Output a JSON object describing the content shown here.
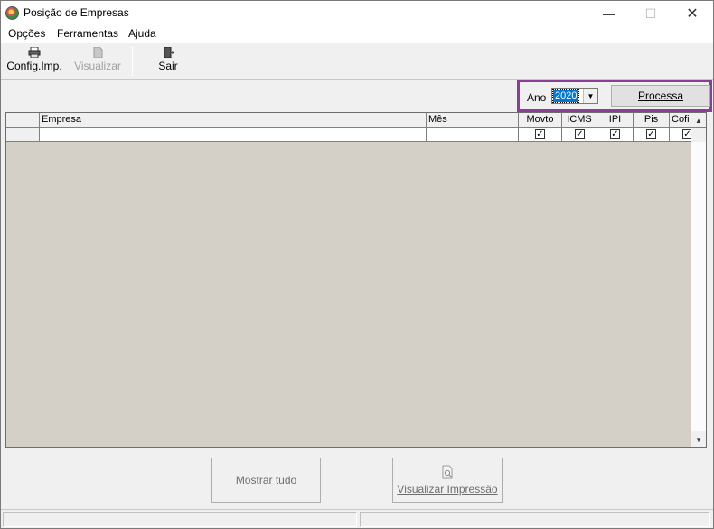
{
  "window": {
    "title": "Posição de Empresas",
    "minimize": "—",
    "maximize": "☐",
    "close": "✕"
  },
  "menu": [
    "Opções",
    "Ferramentas",
    "Ajuda"
  ],
  "toolbar": {
    "config_label": "Config.Imp.",
    "visualizar_label": "Visualizar",
    "sair_label": "Sair"
  },
  "filter": {
    "ano_label": "Ano",
    "ano_value": "2020",
    "processa_label": "Processa"
  },
  "grid": {
    "columns": [
      "Empresa",
      "Mês",
      "Movto",
      "ICMS",
      "IPI",
      "Pis",
      "Cofi"
    ],
    "row_checks": [
      true,
      true,
      true,
      true,
      true
    ]
  },
  "buttons": {
    "mostrar_tudo": "Mostrar tudo",
    "visualizar_impressao": "Visualizar Impressão"
  }
}
